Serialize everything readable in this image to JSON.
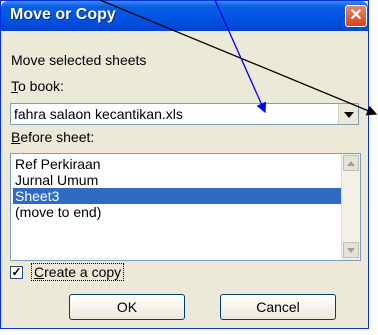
{
  "dialog": {
    "title": "Move or Copy",
    "close_glyph": "✕",
    "instruction": "Move selected sheets",
    "to_book_label_u": "T",
    "to_book_label_rest": "o book:",
    "to_book_value": "fahra salaon kecantikan.xls",
    "before_sheet_label_u": "B",
    "before_sheet_label_rest": "efore sheet:",
    "sheets": [
      "Ref Perkiraan",
      "Jurnal Umum",
      "Sheet3",
      "(move to end)"
    ],
    "selected_sheet_index": 2,
    "create_copy_u": "C",
    "create_copy_rest": "reate a copy",
    "create_copy_checked": true,
    "check_glyph": "✓",
    "ok_label": "OK",
    "cancel_label": "Cancel"
  },
  "colors": {
    "titlebar": "#0054e3",
    "selection": "#316ac5",
    "annotation_blue": "#0000ff",
    "annotation_black": "#000000"
  },
  "icons": [
    "close-icon",
    "dropdown-arrow-icon",
    "scroll-up-icon",
    "scroll-down-icon",
    "checkmark-icon"
  ]
}
